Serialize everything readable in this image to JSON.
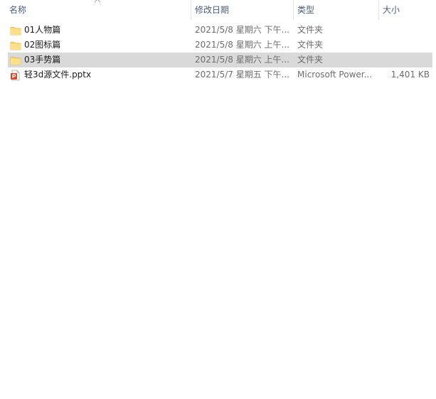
{
  "columns": {
    "name": "名称",
    "date": "修改日期",
    "type": "类型",
    "size": "大小"
  },
  "sort": {
    "column": "name",
    "direction": "ascending",
    "icon": "sort-up-icon"
  },
  "files": [
    {
      "name": "01人物篇",
      "date": "2021/5/8 星期六 下午...",
      "type": "文件夹",
      "size": "",
      "icon": "folder-icon",
      "selected": false
    },
    {
      "name": "02图标篇",
      "date": "2021/5/8 星期六 上午...",
      "type": "文件夹",
      "size": "",
      "icon": "folder-icon",
      "selected": false
    },
    {
      "name": "03手势篇",
      "date": "2021/5/8 星期六 上午...",
      "type": "文件夹",
      "size": "",
      "icon": "folder-icon",
      "selected": true
    },
    {
      "name": "轻3d源文件.pptx",
      "date": "2021/5/7 星期五 下午...",
      "type": "Microsoft Power...",
      "size": "1,401 KB",
      "icon": "powerpoint-file-icon",
      "selected": false
    }
  ],
  "colors": {
    "selection": "#d9d9d9",
    "header_text": "#4c607a",
    "folder_yellow": "#ffd766",
    "powerpoint_orange": "#d24726"
  }
}
